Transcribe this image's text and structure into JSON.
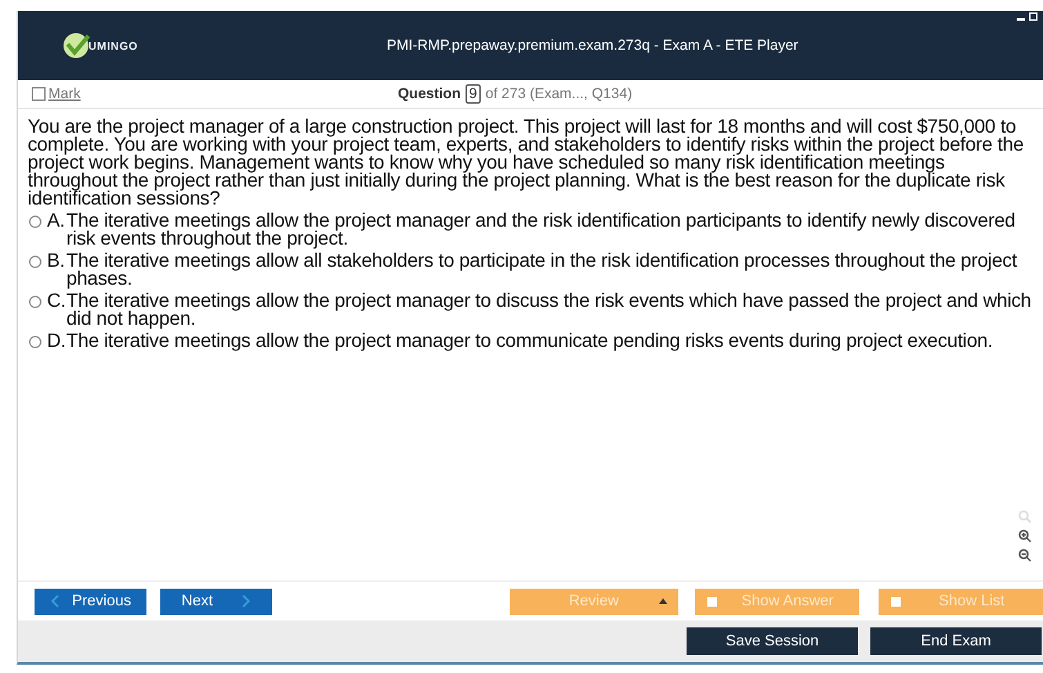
{
  "window": {
    "logo_text": "UMINGO",
    "title": "PMI-RMP.prepaway.premium.exam.273q - Exam A - ETE Player"
  },
  "question_bar": {
    "mark": {
      "label": "Mark",
      "checked": false
    },
    "question_label": "Question",
    "number": "9",
    "of_text": "of 273 (Exam..., Q134)"
  },
  "question": {
    "text": "You are the project manager of a large construction project. This project will last for 18 months and will cost $750,000 to complete. You are working with your project team, experts, and stakeholders to identify risks within the project before the project work begins. Management wants to know why you have scheduled so many risk identification meetings throughout the project rather than just initially during the project planning. What is the best reason for the duplicate risk identification sessions?",
    "options": [
      {
        "letter": "A.",
        "text": "The iterative meetings allow the project manager and the risk identification participants to identify newly discovered risk events throughout the project.",
        "selected": false
      },
      {
        "letter": "B.",
        "text": "The iterative meetings allow all stakeholders to participate in the risk identification processes throughout the project phases.",
        "selected": false
      },
      {
        "letter": "C.",
        "text": "The iterative meetings allow the project manager to discuss the risk events which have passed the project and which did not happen.",
        "selected": false
      },
      {
        "letter": "D.",
        "text": "The iterative meetings allow the project manager to communicate pending risks events during project execution.",
        "selected": false
      }
    ]
  },
  "nav": {
    "previous": "Previous",
    "next": "Next",
    "review": "Review",
    "show_answer": {
      "label": "Show Answer",
      "checked": false
    },
    "show_list": {
      "label": "Show List",
      "checked": false
    }
  },
  "footer": {
    "save": "Save Session",
    "end": "End Exam"
  }
}
